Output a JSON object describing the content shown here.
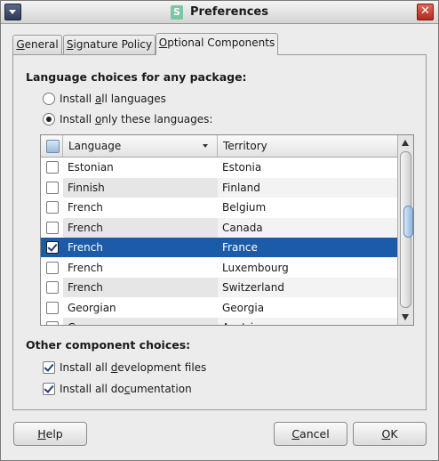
{
  "window": {
    "title": "Preferences",
    "app_icon_glyph": "S",
    "menu_icon": "window-menu-icon",
    "close_icon": "close-icon",
    "close_glyph": "✕"
  },
  "tabs": [
    {
      "label": "General",
      "active": false
    },
    {
      "label": "Signature Policy",
      "active": false
    },
    {
      "label": "Optional Components",
      "active": true
    }
  ],
  "language_section": {
    "heading": "Language choices for any package:",
    "options": [
      {
        "label": "Install all languages",
        "selected": false
      },
      {
        "label": "Install only these languages:",
        "selected": true
      }
    ]
  },
  "language_table": {
    "columns": [
      "Language",
      "Territory"
    ],
    "sort_column": "Language",
    "rows": [
      {
        "language": "Estonian",
        "territory": "Estonia",
        "checked": false
      },
      {
        "language": "Finnish",
        "territory": "Finland",
        "checked": false
      },
      {
        "language": "French",
        "territory": "Belgium",
        "checked": false
      },
      {
        "language": "French",
        "territory": "Canada",
        "checked": false
      },
      {
        "language": "French",
        "territory": "France",
        "checked": true,
        "selected": true
      },
      {
        "language": "French",
        "territory": "Luxembourg",
        "checked": false
      },
      {
        "language": "French",
        "territory": "Switzerland",
        "checked": false
      },
      {
        "language": "Georgian",
        "territory": "Georgia",
        "checked": false
      },
      {
        "language": "German",
        "territory": "Austria",
        "checked": false
      }
    ]
  },
  "other_section": {
    "heading": "Other component choices:",
    "options": [
      {
        "label": "Install all development files",
        "checked": true
      },
      {
        "label": "Install all documentation",
        "checked": true
      }
    ]
  },
  "buttons": {
    "help": "Help",
    "cancel": "Cancel",
    "ok": "OK"
  },
  "colors": {
    "selection": "#1c5ba8",
    "window_bg": "#ececec"
  }
}
